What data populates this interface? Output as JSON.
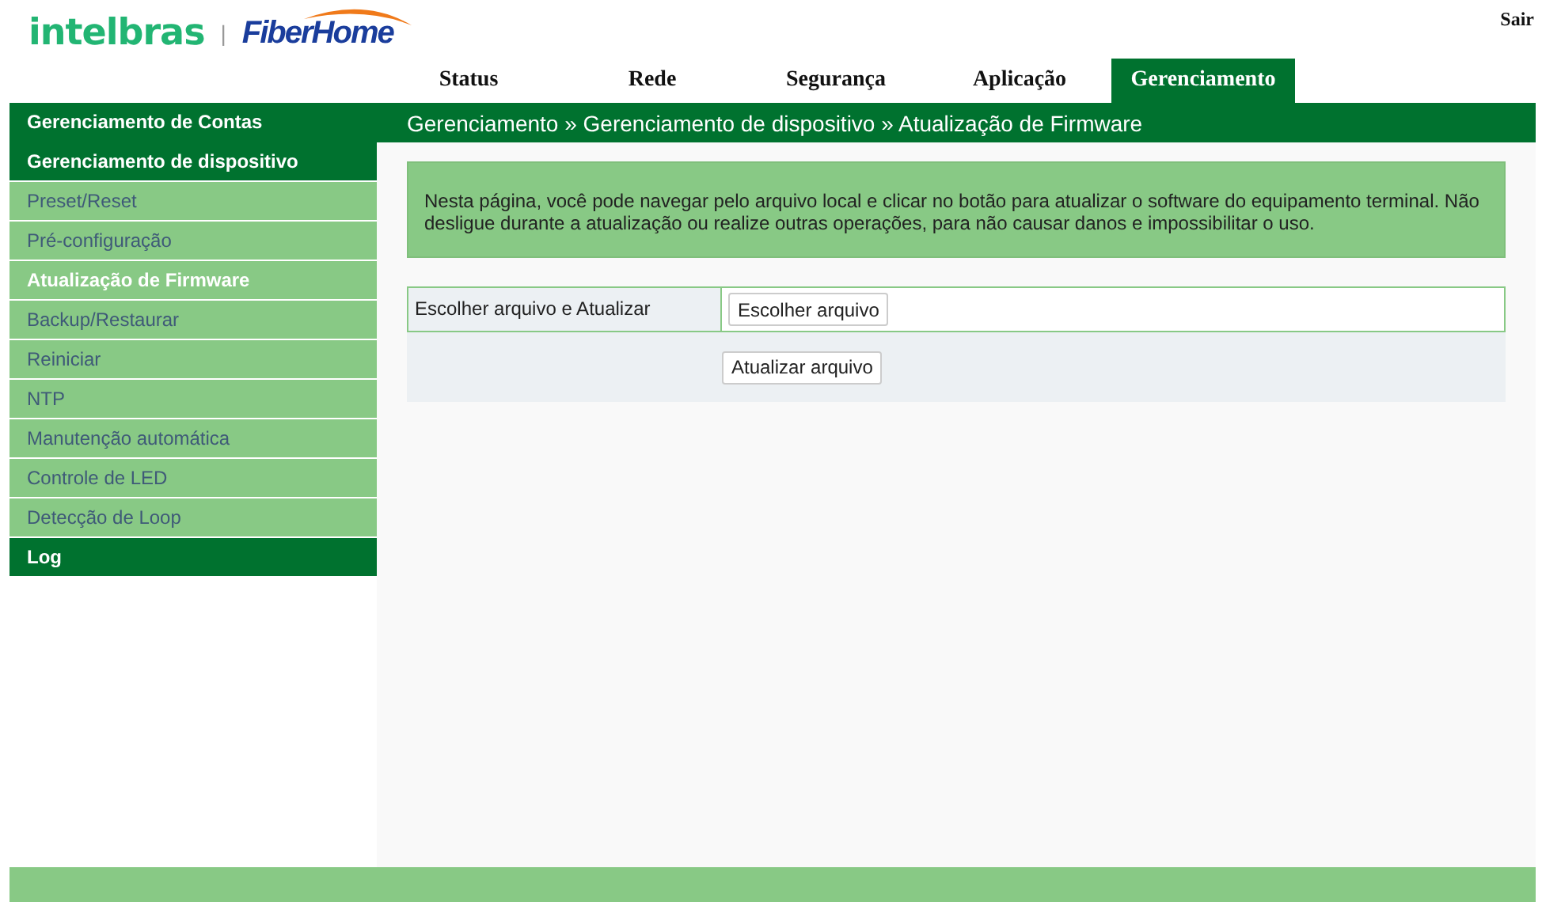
{
  "header": {
    "brand": "intelbras",
    "separator": "|",
    "partner": "FiberHome",
    "logout": "Sair"
  },
  "tabs": [
    {
      "label": "Status",
      "selected": false
    },
    {
      "label": "Rede",
      "selected": false
    },
    {
      "label": "Segurança",
      "selected": false
    },
    {
      "label": "Aplicação",
      "selected": false
    },
    {
      "label": "Gerenciamento",
      "selected": true
    }
  ],
  "sidebar": {
    "items": [
      {
        "kind": "section",
        "label": "Gerenciamento de Contas",
        "selected": false
      },
      {
        "kind": "section",
        "label": "Gerenciamento de dispositivo",
        "selected": false
      },
      {
        "kind": "item",
        "label": "Preset/Reset",
        "selected": false
      },
      {
        "kind": "item",
        "label": "Pré-configuração",
        "selected": false
      },
      {
        "kind": "item",
        "label": "Atualização de Firmware",
        "selected": true
      },
      {
        "kind": "item",
        "label": "Backup/Restaurar",
        "selected": false
      },
      {
        "kind": "item",
        "label": "Reiniciar",
        "selected": false
      },
      {
        "kind": "item",
        "label": "NTP",
        "selected": false
      },
      {
        "kind": "item",
        "label": "Manutenção automática",
        "selected": false
      },
      {
        "kind": "item",
        "label": "Controle de LED",
        "selected": false
      },
      {
        "kind": "item",
        "label": "Detecção de Loop",
        "selected": false
      },
      {
        "kind": "section",
        "label": "Log",
        "selected": false
      }
    ]
  },
  "breadcrumb": "Gerenciamento » Gerenciamento de dispositivo » Atualização de Firmware",
  "notice": "Nesta página, você pode navegar pelo arquivo local e clicar no botão para atualizar o software do equipamento terminal. Não desligue durante a atualização ou realize outras operações, para não causar danos e impossibilitar o uso.",
  "form": {
    "label": "Escolher arquivo e Atualizar",
    "choose_button": "Escolher arquivo",
    "upload_button": "Atualizar arquivo"
  }
}
